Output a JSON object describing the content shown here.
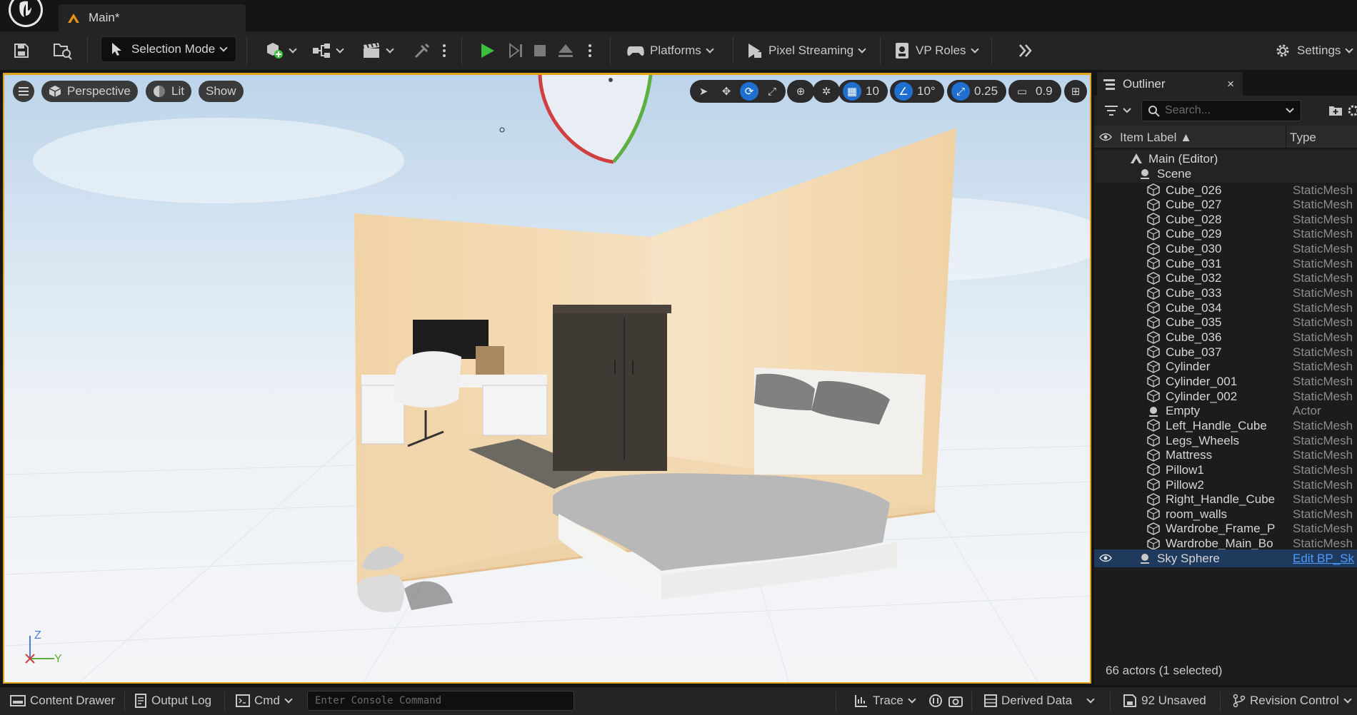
{
  "document_tab": {
    "title": "Main*"
  },
  "toolbar": {
    "selection_mode": "Selection Mode",
    "platforms": "Platforms",
    "pixel_streaming": "Pixel Streaming",
    "vp_roles": "VP Roles",
    "settings": "Settings"
  },
  "viewport": {
    "perspective": "Perspective",
    "lit": "Lit",
    "show": "Show",
    "grid_snap": "10",
    "rotation_snap": "10°",
    "scale_snap": "0.25",
    "camera_speed": "0.9",
    "axis_z": "Z",
    "axis_y": "Y",
    "accent": "#e1a21a"
  },
  "outliner": {
    "tab_title": "Outliner",
    "close": "×",
    "search_placeholder": "Search...",
    "col_label": "Item Label ▲",
    "col_type": "Type",
    "items": [
      {
        "label": "Main (Editor)",
        "type": "",
        "indent": 1,
        "icon": "level-icon"
      },
      {
        "label": "Scene",
        "type": "",
        "indent": 2,
        "icon": "actor-icon"
      },
      {
        "label": "Cube_026",
        "type": "StaticMesh",
        "indent": 3,
        "icon": "mesh-icon"
      },
      {
        "label": "Cube_027",
        "type": "StaticMesh",
        "indent": 3,
        "icon": "mesh-icon"
      },
      {
        "label": "Cube_028",
        "type": "StaticMesh",
        "indent": 3,
        "icon": "mesh-icon"
      },
      {
        "label": "Cube_029",
        "type": "StaticMesh",
        "indent": 3,
        "icon": "mesh-icon"
      },
      {
        "label": "Cube_030",
        "type": "StaticMesh",
        "indent": 3,
        "icon": "mesh-icon"
      },
      {
        "label": "Cube_031",
        "type": "StaticMesh",
        "indent": 3,
        "icon": "mesh-icon"
      },
      {
        "label": "Cube_032",
        "type": "StaticMesh",
        "indent": 3,
        "icon": "mesh-icon"
      },
      {
        "label": "Cube_033",
        "type": "StaticMesh",
        "indent": 3,
        "icon": "mesh-icon"
      },
      {
        "label": "Cube_034",
        "type": "StaticMesh",
        "indent": 3,
        "icon": "mesh-icon"
      },
      {
        "label": "Cube_035",
        "type": "StaticMesh",
        "indent": 3,
        "icon": "mesh-icon"
      },
      {
        "label": "Cube_036",
        "type": "StaticMesh",
        "indent": 3,
        "icon": "mesh-icon"
      },
      {
        "label": "Cube_037",
        "type": "StaticMesh",
        "indent": 3,
        "icon": "mesh-icon"
      },
      {
        "label": "Cylinder",
        "type": "StaticMesh",
        "indent": 3,
        "icon": "mesh-icon"
      },
      {
        "label": "Cylinder_001",
        "type": "StaticMesh",
        "indent": 3,
        "icon": "mesh-icon"
      },
      {
        "label": "Cylinder_002",
        "type": "StaticMesh",
        "indent": 3,
        "icon": "mesh-icon"
      },
      {
        "label": "Empty",
        "type": "Actor",
        "indent": 3,
        "icon": "actor-icon"
      },
      {
        "label": "Left_Handle_Cube",
        "type": "StaticMesh",
        "indent": 3,
        "icon": "mesh-icon"
      },
      {
        "label": "Legs_Wheels",
        "type": "StaticMesh",
        "indent": 3,
        "icon": "mesh-icon"
      },
      {
        "label": "Mattress",
        "type": "StaticMesh",
        "indent": 3,
        "icon": "mesh-icon"
      },
      {
        "label": "Pillow1",
        "type": "StaticMesh",
        "indent": 3,
        "icon": "mesh-icon"
      },
      {
        "label": "Pillow2",
        "type": "StaticMesh",
        "indent": 3,
        "icon": "mesh-icon"
      },
      {
        "label": "Right_Handle_Cube",
        "type": "StaticMesh",
        "indent": 3,
        "icon": "mesh-icon"
      },
      {
        "label": "room_walls",
        "type": "StaticMesh",
        "indent": 3,
        "icon": "mesh-icon"
      },
      {
        "label": "Wardrobe_Frame_P",
        "type": "StaticMesh",
        "indent": 3,
        "icon": "mesh-icon"
      },
      {
        "label": "Wardrobe_Main_Bo",
        "type": "StaticMesh",
        "indent": 3,
        "icon": "mesh-icon"
      },
      {
        "label": "Sky Sphere",
        "type": "Edit BP_Sk",
        "indent": 2,
        "icon": "actor-icon",
        "selected": true
      }
    ],
    "footer": "66 actors (1 selected)",
    "selection_color": "#1f3a5c",
    "link_color": "#4d9bff"
  },
  "statusbar": {
    "content_drawer": "Content Drawer",
    "output_log": "Output Log",
    "cmd": "Cmd",
    "console_placeholder": "Enter Console Command",
    "trace": "Trace",
    "derived_data": "Derived Data",
    "unsaved": "92 Unsaved",
    "revision_control": "Revision Control"
  }
}
